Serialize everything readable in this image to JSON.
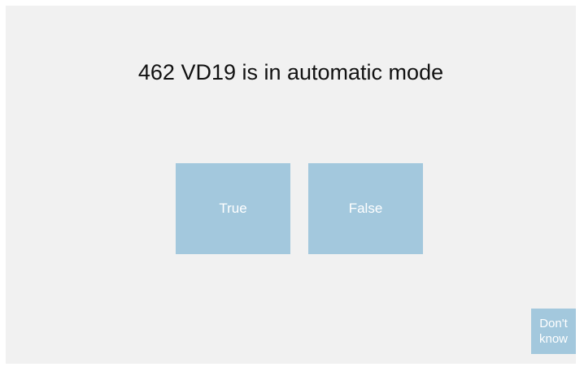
{
  "question": {
    "text": "462 VD19 is in automatic mode"
  },
  "answers": {
    "true_label": "True",
    "false_label": "False"
  },
  "dont_know": {
    "label": "Don't\nknow"
  },
  "colors": {
    "panel_background": "#f1f1f1",
    "button_background": "#a3c8dd",
    "button_text": "#ffffff",
    "question_text": "#111111"
  }
}
